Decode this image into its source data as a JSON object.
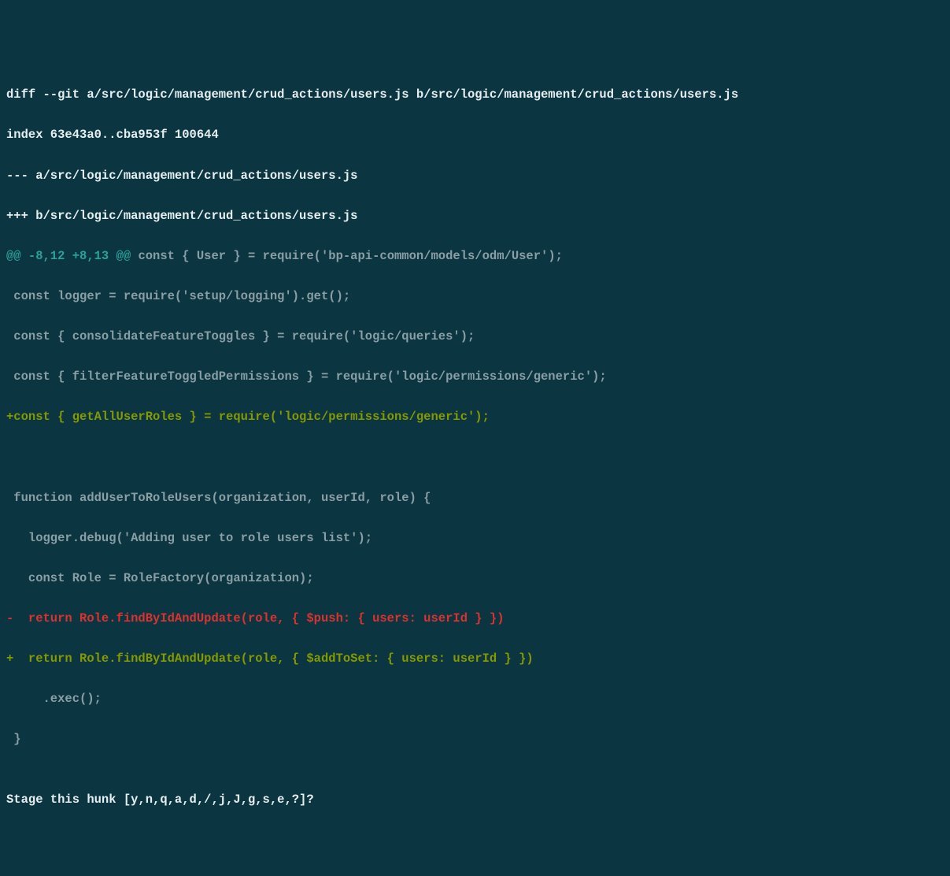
{
  "diff": {
    "header": "diff --git a/src/logic/management/crud_actions/users.js b/src/logic/management/crud_actions/users.js",
    "index_line": "index 63e43a0..cba953f 100644",
    "minus_file": "--- a/src/logic/management/crud_actions/users.js",
    "plus_file": "+++ b/src/logic/management/crud_actions/users.js",
    "hunk": {
      "marker_left": "@@ ",
      "range": "-8,12 +8,13",
      "marker_right": " @@",
      "context": " const { User } = require('bp-api-common/models/odm/User');"
    },
    "lines": {
      "ctx1": " const logger = require('setup/logging').get();",
      "ctx2": " const { consolidateFeatureToggles } = require('logic/queries');",
      "ctx3": " const { filterFeatureToggledPermissions } = require('logic/permissions/generic');",
      "add1": "+const { getAllUserRoles } = require('logic/permissions/generic');",
      "blank1": "",
      "blank2": "",
      "ctx4": " function addUserToRoleUsers(organization, userId, role) {",
      "ctx5": "   logger.debug('Adding user to role users list');",
      "ctx6": "   const Role = RoleFactory(organization);",
      "del1": "-  return Role.findByIdAndUpdate(role, { $push: { users: userId } })",
      "add2": "+  return Role.findByIdAndUpdate(role, { $addToSet: { users: userId } })",
      "ctx7": "     .exec();",
      "ctx8": " }",
      "blank3": ""
    },
    "prompt": "Stage this hunk [y,n,q,a,d,/,j,J,g,s,e,?]? "
  }
}
